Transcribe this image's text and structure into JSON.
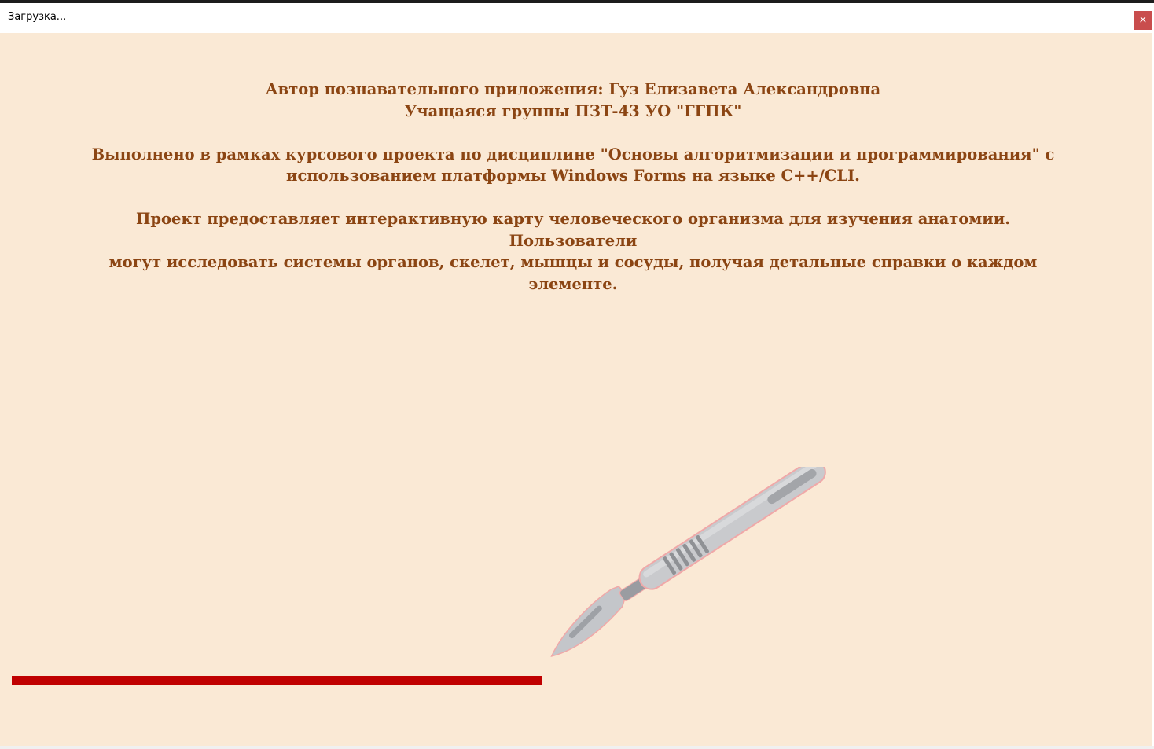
{
  "window": {
    "title": "Загрузка...",
    "close_label": "×"
  },
  "info": {
    "author_line": "Автор познавательного приложения: Гуз Елизавета Александровна",
    "group_line": "Учащаяся группы ПЗТ-43 УО \"ГГПК\"",
    "project_line_1": "Выполнено в рамках курсового проекта по дисциплине \"Основы алгоритмизации и программирования\" с",
    "project_line_2": "использованием платформы Windows Forms на языке C++/CLI.",
    "desc_line_1": "Проект предоставляет интерактивную карту человеческого организма для изучения анатомии. Пользователи",
    "desc_line_2": "могут исследовать системы органов, скелет, мышцы и сосуды, получая детальные справки о каждом",
    "desc_line_3": "элементе."
  },
  "progress": {
    "fraction": 0.46,
    "color": "#c00000"
  },
  "icons": {
    "scalpel": "scalpel-icon"
  },
  "colors": {
    "background": "#fae9d5",
    "text": "#8b4513",
    "close_button": "#c94d4d"
  }
}
